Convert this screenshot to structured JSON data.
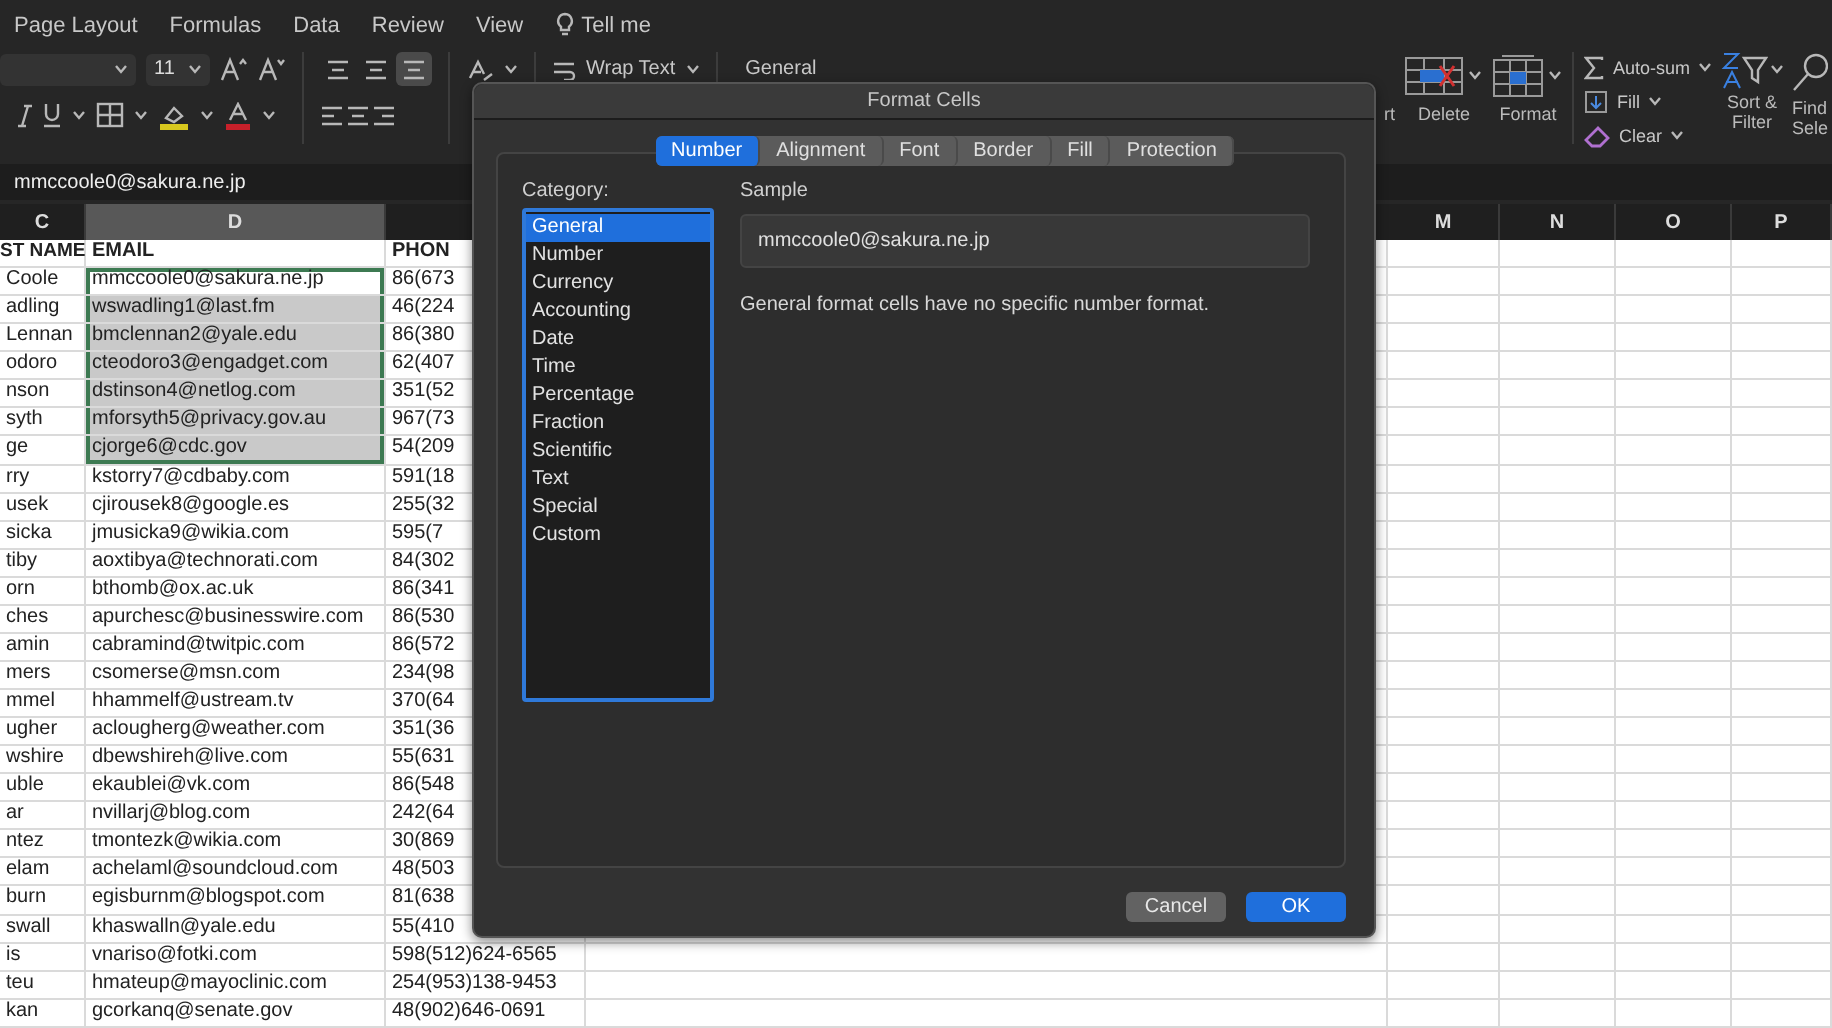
{
  "menu_tabs": [
    {
      "label": "Page Layout",
      "kind": "tab"
    },
    {
      "label": "Formulas",
      "kind": "tab"
    },
    {
      "label": "Data",
      "kind": "tab"
    },
    {
      "label": "Review",
      "kind": "tab"
    },
    {
      "label": "View",
      "kind": "tab"
    },
    {
      "label": "Tell me",
      "kind": "help"
    }
  ],
  "ribbon": {
    "font_size": "11",
    "vertical_alignment": [
      {
        "selected": false
      },
      {
        "selected": false
      },
      {
        "selected": true
      }
    ],
    "wrap_text": "Wrap Text",
    "number_format": "General",
    "cells_buttons": [
      {
        "label": "rt",
        "kind": "insert"
      },
      {
        "label": "Delete",
        "kind": "delete"
      },
      {
        "label": "Format",
        "kind": "format"
      }
    ],
    "editing": [
      {
        "label": "Auto-sum",
        "kind": "sum"
      },
      {
        "label": "Fill",
        "kind": "fill"
      },
      {
        "label": "Clear",
        "kind": "clear"
      }
    ],
    "sort_filter": "Sort & Filter",
    "find_select": "Find Sele"
  },
  "formula_bar": {
    "value": "mmccoole0@sakura.ne.jp"
  },
  "sheet": {
    "columns_left": [
      {
        "label": "C",
        "selected": false
      },
      {
        "label": "D",
        "selected": true
      }
    ],
    "columns_right": [
      {
        "label": "M",
        "selected": false
      },
      {
        "label": "N",
        "selected": false
      },
      {
        "label": "O",
        "selected": false
      },
      {
        "label": "P",
        "selected": false
      }
    ],
    "header_row": [
      "ST NAME",
      "EMAIL",
      "PHON"
    ],
    "rows": [
      {
        "cells": [
          "Coole",
          "mmccoole0@sakura.ne.jp",
          "86(673"
        ],
        "selected": true
      },
      {
        "cells": [
          "adling",
          "wswadling1@last.fm",
          "46(224"
        ],
        "selected": true
      },
      {
        "cells": [
          "Lennan",
          "bmclennan2@yale.edu",
          "86(380"
        ],
        "selected": true
      },
      {
        "cells": [
          "odoro",
          "cteodoro3@engadget.com",
          "62(407"
        ],
        "selected": true
      },
      {
        "cells": [
          "nson",
          "dstinson4@netlog.com",
          "351(52"
        ],
        "selected": true
      },
      {
        "cells": [
          "syth",
          "mforsyth5@privacy.gov.au",
          "967(73"
        ],
        "selected": true
      },
      {
        "cells": [
          "ge",
          "cjorge6@cdc.gov",
          "54(209"
        ],
        "selected": true
      },
      {
        "cells": [
          "rry",
          "kstorry7@cdbaby.com",
          "591(18"
        ],
        "selected": false
      },
      {
        "cells": [
          "usek",
          "cjirousek8@google.es",
          "255(32"
        ],
        "selected": false
      },
      {
        "cells": [
          "sicka",
          "jmusicka9@wikia.com",
          "595(7"
        ],
        "selected": false
      },
      {
        "cells": [
          "tiby",
          "aoxtibya@technorati.com",
          "84(302"
        ],
        "selected": false
      },
      {
        "cells": [
          "orn",
          "bthomb@ox.ac.uk",
          "86(341"
        ],
        "selected": false
      },
      {
        "cells": [
          "ches",
          "apurchesc@businesswire.com",
          "86(530"
        ],
        "selected": false
      },
      {
        "cells": [
          "amin",
          "cabramind@twitpic.com",
          "86(572"
        ],
        "selected": false
      },
      {
        "cells": [
          "mers",
          "csomerse@msn.com",
          "234(98"
        ],
        "selected": false
      },
      {
        "cells": [
          "mmel",
          "hhammelf@ustream.tv",
          "370(64"
        ],
        "selected": false
      },
      {
        "cells": [
          "ugher",
          "aclougherg@weather.com",
          "351(36"
        ],
        "selected": false
      },
      {
        "cells": [
          "wshire",
          "dbewshireh@live.com",
          "55(631"
        ],
        "selected": false
      },
      {
        "cells": [
          "uble",
          "ekaublei@vk.com",
          "86(548"
        ],
        "selected": false
      },
      {
        "cells": [
          "ar",
          "nvillarj@blog.com",
          "242(64"
        ],
        "selected": false
      },
      {
        "cells": [
          "ntez",
          "tmontezk@wikia.com",
          "30(869"
        ],
        "selected": false
      },
      {
        "cells": [
          "elam",
          "achelaml@soundcloud.com",
          "48(503"
        ],
        "selected": false
      },
      {
        "cells": [
          "burn",
          "egisburnm@blogspot.com",
          "81(638"
        ],
        "selected": false
      },
      {
        "cells": [
          "swall",
          "khaswalln@yale.edu",
          "55(410"
        ],
        "selected": false
      },
      {
        "cells": [
          "is",
          "vnariso@fotki.com",
          "598(512)624-6565"
        ],
        "selected": false
      },
      {
        "cells": [
          "teu",
          "hmateup@mayoclinic.com",
          "254(953)138-9453"
        ],
        "selected": false
      },
      {
        "cells": [
          "kan",
          "gcorkanq@senate.gov",
          "48(902)646-0691"
        ],
        "selected": false
      }
    ]
  },
  "dialog": {
    "title": "Format Cells",
    "tabs": [
      {
        "label": "Number",
        "selected": true
      },
      {
        "label": "Alignment",
        "selected": false
      },
      {
        "label": "Font",
        "selected": false
      },
      {
        "label": "Border",
        "selected": false
      },
      {
        "label": "Fill",
        "selected": false
      },
      {
        "label": "Protection",
        "selected": false
      }
    ],
    "category_label": "Category:",
    "categories": [
      {
        "label": "General",
        "selected": true
      },
      {
        "label": "Number",
        "selected": false
      },
      {
        "label": "Currency",
        "selected": false
      },
      {
        "label": "Accounting",
        "selected": false
      },
      {
        "label": "Date",
        "selected": false
      },
      {
        "label": "Time",
        "selected": false
      },
      {
        "label": "Percentage",
        "selected": false
      },
      {
        "label": "Fraction",
        "selected": false
      },
      {
        "label": "Scientific",
        "selected": false
      },
      {
        "label": "Text",
        "selected": false
      },
      {
        "label": "Special",
        "selected": false
      },
      {
        "label": "Custom",
        "selected": false
      }
    ],
    "sample_label": "Sample",
    "sample_value": "mmccoole0@sakura.ne.jp",
    "description": "General format cells have no specific number format.",
    "buttons": [
      {
        "label": "Cancel",
        "kind": "secondary"
      },
      {
        "label": "OK",
        "kind": "primary"
      }
    ]
  }
}
